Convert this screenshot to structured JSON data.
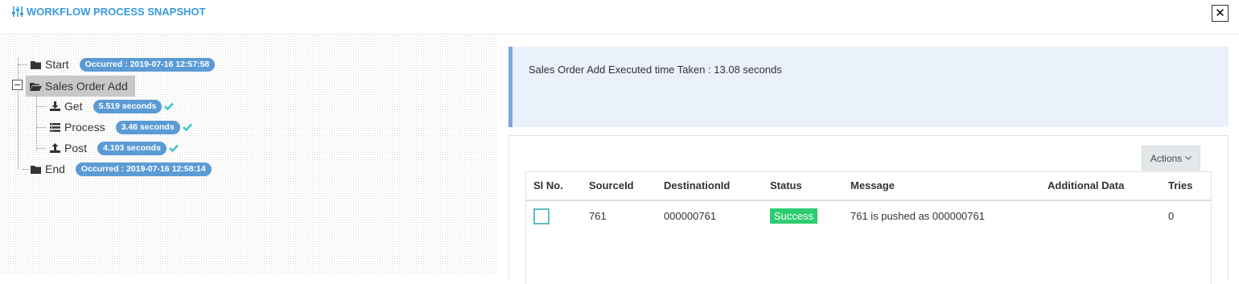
{
  "header": {
    "title": "WORKFLOW PROCESS SNAPSHOT",
    "title_icon": "sliders-icon",
    "close_label": "✕"
  },
  "tree": {
    "start": {
      "label": "Start",
      "badge": "Occurred : 2019-07-16 12:57:58"
    },
    "group": {
      "label": "Sales Order Add",
      "expanded": true,
      "selected": true
    },
    "steps": [
      {
        "label": "Get",
        "badge": "5.519 seconds",
        "icon": "download-icon",
        "done": true
      },
      {
        "label": "Process",
        "badge": "3.46 seconds",
        "icon": "list-icon",
        "done": true
      },
      {
        "label": "Post",
        "badge": "4.103 seconds",
        "icon": "upload-icon",
        "done": true
      }
    ],
    "end": {
      "label": "End",
      "badge": "Occurred : 2019-07-16 12:58:14"
    }
  },
  "info": {
    "message": "Sales Order Add Executed time Taken : 13.08 seconds"
  },
  "actions": {
    "label": "Actions"
  },
  "table": {
    "columns": [
      "Sl No.",
      "SourceId",
      "DestinationId",
      "Status",
      "Message",
      "Additional Data",
      "Tries"
    ],
    "rows": [
      {
        "source_id": "761",
        "destination_id": "000000761",
        "status": "Success",
        "message": "761 is pushed as 000000761",
        "additional_data": "",
        "tries": "0",
        "checked": false
      }
    ]
  },
  "colors": {
    "accent": "#3a9ad9",
    "badge": "#5b9bd5",
    "success": "#2ecc71",
    "check": "#3cc7c7",
    "info_border": "#7ba7dc"
  }
}
